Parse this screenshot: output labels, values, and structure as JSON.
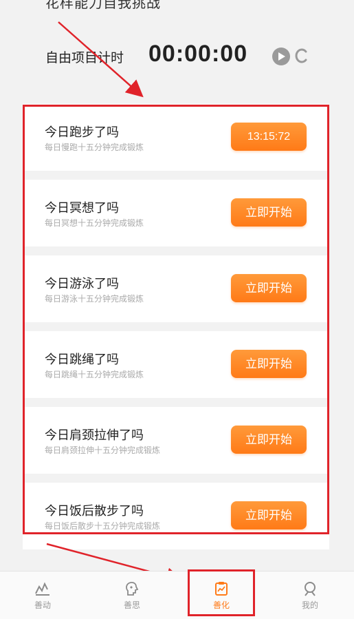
{
  "header": {
    "cut_off_text": "花样能力自我挑战",
    "timer_label": "自由项目计时",
    "timer_value": "00:00:00"
  },
  "activities": [
    {
      "title": "今日跑步了吗",
      "subtitle": "每日慢跑十五分钟完成锻炼",
      "button": "13:15:72"
    },
    {
      "title": "今日冥想了吗",
      "subtitle": "每日冥想十五分钟完成锻炼",
      "button": "立即开始"
    },
    {
      "title": "今日游泳了吗",
      "subtitle": "每日游泳十五分钟完成锻炼",
      "button": "立即开始"
    },
    {
      "title": "今日跳绳了吗",
      "subtitle": "每日跳绳十五分钟完成锻炼",
      "button": "立即开始"
    },
    {
      "title": "今日肩颈拉伸了吗",
      "subtitle": "每日肩颈拉伸十五分钟完成锻炼",
      "button": "立即开始"
    },
    {
      "title": "今日饭后散步了吗",
      "subtitle": "每日饭后散步十五分钟完成锻炼",
      "button": "立即开始"
    }
  ],
  "tabs": [
    {
      "label": "善动",
      "icon": "activity-icon"
    },
    {
      "label": "善思",
      "icon": "brain-icon"
    },
    {
      "label": "善化",
      "icon": "clipboard-chart-icon"
    },
    {
      "label": "我的",
      "icon": "user-icon"
    }
  ],
  "colors": {
    "accent": "#ff7a17",
    "highlight": "#e0232a"
  }
}
